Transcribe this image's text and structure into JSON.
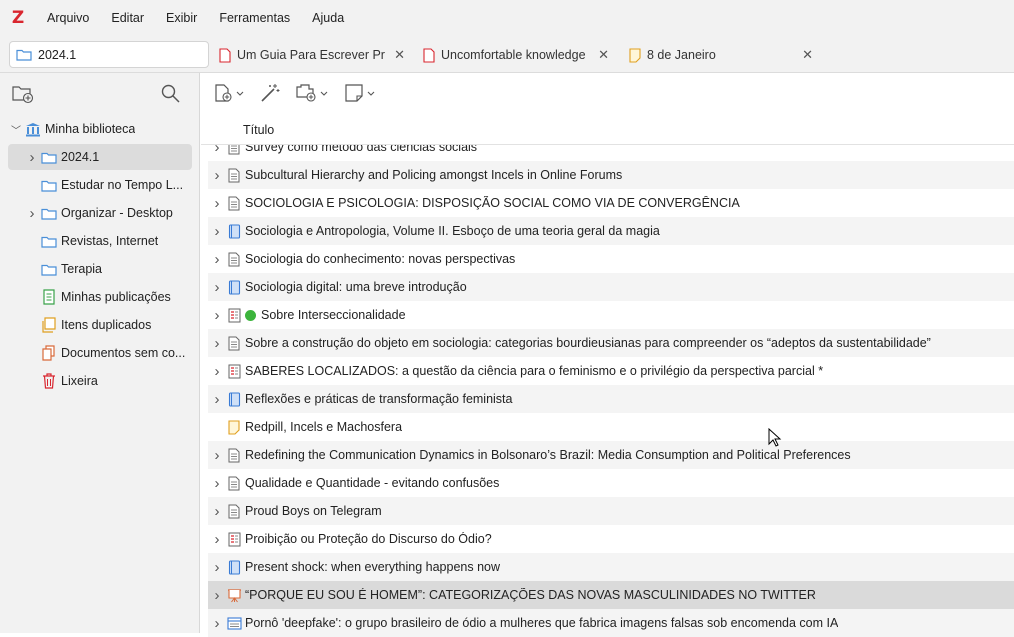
{
  "menu": [
    "Arquivo",
    "Editar",
    "Exibir",
    "Ferramentas",
    "Ajuda"
  ],
  "tabs": {
    "library": "2024.1",
    "docs": [
      {
        "label": "Um Guia Para Escrever Pr",
        "icon": "pdf-icon"
      },
      {
        "label": "Uncomfortable knowledge",
        "icon": "pdf-icon"
      },
      {
        "label": "8 de Janeiro",
        "icon": "note-icon"
      }
    ]
  },
  "sidebar": {
    "root": "Minha biblioteca",
    "items": [
      {
        "label": "2024.1",
        "icon": "folder-icon",
        "expandable": true,
        "selected": true
      },
      {
        "label": "Estudar no Tempo L...",
        "icon": "folder-icon",
        "expandable": false
      },
      {
        "label": "Organizar - Desktop",
        "icon": "folder-icon",
        "expandable": true
      },
      {
        "label": "Revistas, Internet",
        "icon": "folder-icon",
        "expandable": false
      },
      {
        "label": "Terapia",
        "icon": "folder-icon",
        "expandable": false
      },
      {
        "label": "Minhas publicações",
        "icon": "publications-icon",
        "expandable": false
      },
      {
        "label": "Itens duplicados",
        "icon": "duplicates-icon",
        "expandable": false
      },
      {
        "label": "Documentos sem co...",
        "icon": "unfiled-icon",
        "expandable": false
      },
      {
        "label": "Lixeira",
        "icon": "trash-icon",
        "expandable": false
      }
    ]
  },
  "table": {
    "column_title": "Título",
    "rows": [
      {
        "title": "Survey como método das ciências sociais",
        "type": "document",
        "expandable": true
      },
      {
        "title": "Subcultural Hierarchy and Policing amongst Incels in Online Forums",
        "type": "document",
        "expandable": true
      },
      {
        "title": "SOCIOLOGIA E PSICOLOGIA: DISPOSIÇÃO SOCIAL COMO VIA DE CONVERGÊNCIA",
        "type": "document",
        "expandable": true
      },
      {
        "title": "Sociologia e Antropologia, Volume II. Esboço de uma teoria geral da magia",
        "type": "book",
        "expandable": true
      },
      {
        "title": "Sociologia do conhecimento: novas perspectivas",
        "type": "document",
        "expandable": true
      },
      {
        "title": "Sociologia digital: uma breve introdução",
        "type": "book",
        "expandable": true
      },
      {
        "title": "Sobre Interseccionalidade",
        "type": "article",
        "expandable": true,
        "tag": "green"
      },
      {
        "title": "Sobre a construção do objeto em sociologia: categorias bourdieusianas para compreender os “adeptos da sustentabilidade”",
        "type": "document",
        "expandable": true
      },
      {
        "title": "SABERES LOCALIZADOS: a questão da ciência para o feminismo e o privilégio da perspectiva parcial *",
        "type": "article",
        "expandable": true
      },
      {
        "title": "Reflexões e práticas de transformação feminista",
        "type": "book",
        "expandable": true
      },
      {
        "title": "Redpill, Incels e Machosfera",
        "type": "note",
        "expandable": false
      },
      {
        "title": "Redefining the Communication Dynamics in Bolsonaro’s Brazil: Media Consumption and Political Preferences",
        "type": "document",
        "expandable": true
      },
      {
        "title": "Qualidade e Quantidade - evitando confusões",
        "type": "document",
        "expandable": true
      },
      {
        "title": "Proud Boys on Telegram",
        "type": "document",
        "expandable": true
      },
      {
        "title": "Proibição ou Proteção do Discurso do Ódio?",
        "type": "article",
        "expandable": true
      },
      {
        "title": "Present shock: when everything happens now",
        "type": "book",
        "expandable": true
      },
      {
        "title": "“PORQUE EU SOU É HOMEM”: CATEGORIZAÇÕES DAS NOVAS MASCULINIDADES NO TWITTER",
        "type": "presentation",
        "expandable": true,
        "selected": true
      },
      {
        "title": "Pornô 'deepfake': o grupo brasileiro de ódio a mulheres que fabrica imagens falsas sob encomenda com IA",
        "type": "webpage",
        "expandable": true
      }
    ]
  },
  "colors": {
    "brand": "#d9262f",
    "folder": "#4a8fd8",
    "tag_green": "#3cb43c"
  }
}
